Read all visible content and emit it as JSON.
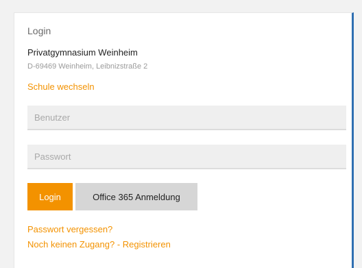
{
  "login": {
    "heading": "Login",
    "school_name": "Privatgymnasium Weinheim",
    "school_address": "D-69469 Weinheim, Leibnizstraße 2",
    "switch_school": "Schule wechseln",
    "username_placeholder": "Benutzer",
    "password_placeholder": "Passwort",
    "login_button": "Login",
    "office_button": "Office 365 Anmeldung",
    "forgot_password": "Passwort vergessen?",
    "register": "Noch keinen Zugang? - Registrieren"
  },
  "colors": {
    "accent": "#f39200",
    "field_bg": "#efefef",
    "secondary_button": "#d6d6d6",
    "frame_border": "#2f6fb1"
  }
}
